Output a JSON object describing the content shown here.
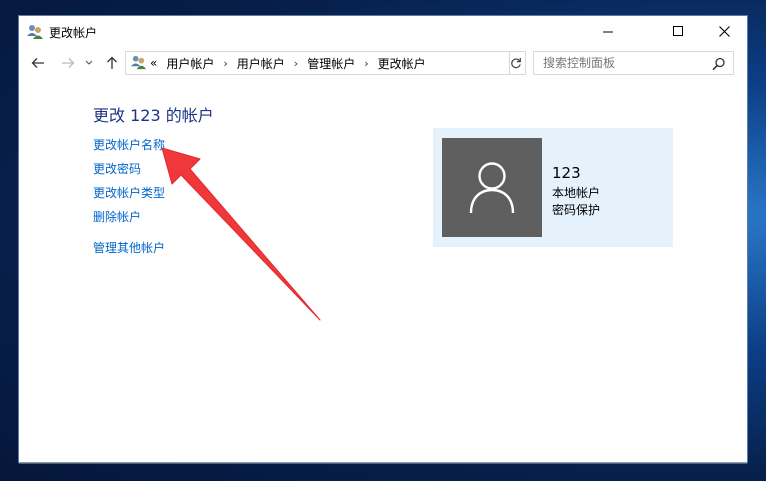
{
  "window": {
    "title": "更改帐户"
  },
  "controls": {
    "minimize": "minimize",
    "maximize": "maximize",
    "close": "close"
  },
  "nav": {
    "overflow": "«",
    "breadcrumbs": [
      "用户帐户",
      "用户帐户",
      "管理帐户",
      "更改帐户"
    ],
    "separator": "›",
    "search_placeholder": "搜索控制面板"
  },
  "main": {
    "heading": "更改 123 的帐户",
    "links": [
      "更改帐户名称",
      "更改密码",
      "更改帐户类型",
      "删除帐户",
      "管理其他帐户"
    ]
  },
  "account": {
    "name": "123",
    "type": "本地帐户",
    "password_status": "密码保护"
  },
  "colors": {
    "link": "#0066cc",
    "heading": "#1e3287",
    "card": "#e5f1fb",
    "avatar": "#5f5f5f",
    "annotation_arrow": "#f0373a"
  },
  "icons": {
    "app": "users-icon",
    "back": "arrow-left-icon",
    "forward": "arrow-right-icon",
    "recent": "chevron-down-icon",
    "up": "arrow-up-icon",
    "refresh": "refresh-icon",
    "search": "search-icon"
  }
}
